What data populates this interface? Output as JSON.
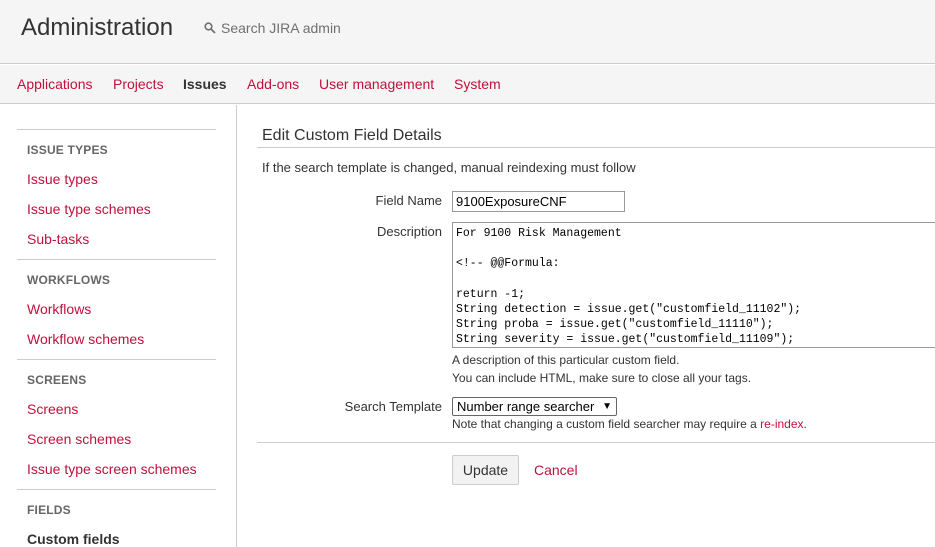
{
  "header": {
    "title": "Administration",
    "search_placeholder": "Search JIRA admin"
  },
  "nav": {
    "tabs": [
      {
        "label": "Applications",
        "active": false
      },
      {
        "label": "Projects",
        "active": false
      },
      {
        "label": "Issues",
        "active": true
      },
      {
        "label": "Add-ons",
        "active": false
      },
      {
        "label": "User management",
        "active": false
      },
      {
        "label": "System",
        "active": false
      }
    ]
  },
  "sidebar": {
    "issue_types_heading": "ISSUE TYPES",
    "issue_types": "Issue types",
    "issue_type_schemes": "Issue type schemes",
    "sub_tasks": "Sub-tasks",
    "workflows_heading": "WORKFLOWS",
    "workflows": "Workflows",
    "workflow_schemes": "Workflow schemes",
    "screens_heading": "SCREENS",
    "screens": "Screens",
    "screen_schemes": "Screen schemes",
    "issue_type_screen_schemes": "Issue type screen schemes",
    "fields_heading": "FIELDS",
    "custom_fields": "Custom fields"
  },
  "form": {
    "title": "Edit Custom Field Details",
    "notice": "If the search template is changed, manual reindexing must follow",
    "field_name_label": "Field Name",
    "field_name_value": "9100ExposureCNF",
    "description_label": "Description",
    "description_lines": [
      "For 9100 Risk Management",
      "",
      "<!-- @@Formula:",
      "",
      "return -1;",
      "String detection = issue.get(\"customfield_11102\");",
      "String proba = issue.get(\"customfield_11110\");",
      "String severity = issue.get(\"customfield_11109\");"
    ],
    "description_help_1": "A description of this particular custom field.",
    "description_help_2": "You can include HTML, make sure to close all your tags.",
    "search_template_label": "Search Template",
    "search_template_value": "Number range searcher",
    "search_help_prefix": "Note that changing a custom field searcher may require a ",
    "search_help_link": "re-index",
    "search_help_suffix": ".",
    "update_label": "Update",
    "cancel_label": "Cancel"
  },
  "colors": {
    "link": "#c0103c",
    "header_bg": "#f5f5f5"
  }
}
